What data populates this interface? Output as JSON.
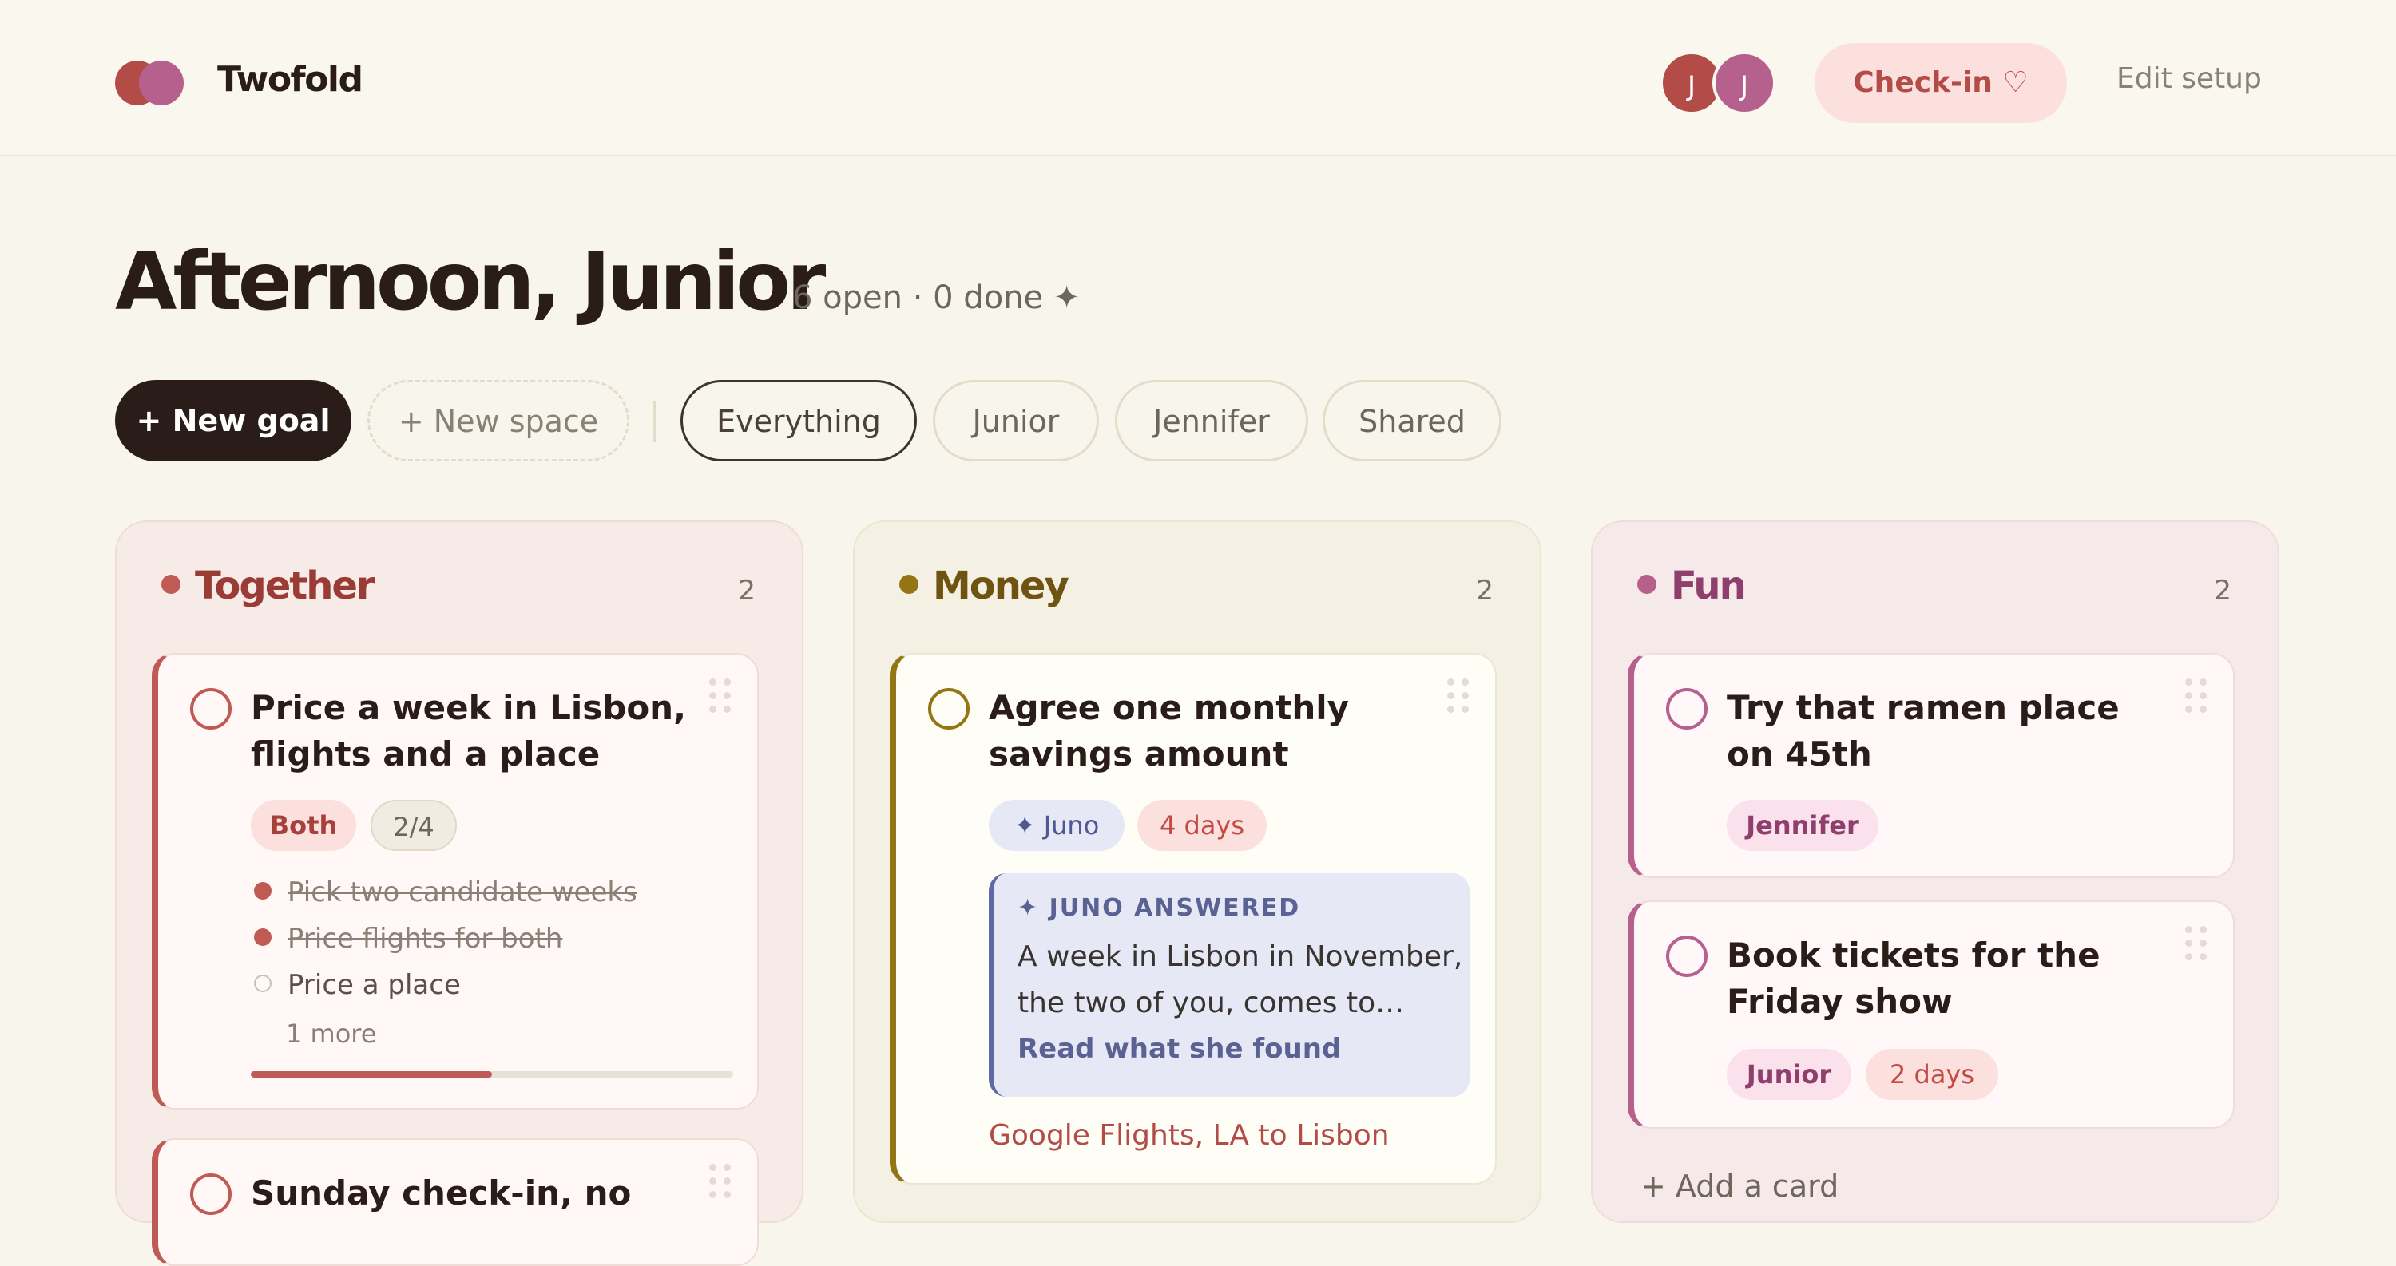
{
  "app": {
    "name": "Twofold"
  },
  "header": {
    "avatars": [
      {
        "initial": "J",
        "color": "#b34b46"
      },
      {
        "initial": "J",
        "color": "#b6608e"
      }
    ],
    "checkin_label": "Check-in ♡",
    "edit_label": "Edit setup"
  },
  "greeting": {
    "title": "Afternoon, Junior",
    "summary": "6 open · 0 done ✦"
  },
  "toolbar": {
    "new_goal": "+ New goal",
    "new_space": "+ New space",
    "filters": [
      "Everything",
      "Junior",
      "Jennifer",
      "Shared"
    ],
    "active_filter": "Everything"
  },
  "columns": [
    {
      "name": "Together",
      "count": "2",
      "color": "#b34b46",
      "cards": [
        {
          "title": "Price a week in Lisbon, flights and a place",
          "tags": [
            "Both",
            "2/4"
          ],
          "subtasks": [
            {
              "label": "Pick two candidate weeks",
              "done": true
            },
            {
              "label": "Price flights for both",
              "done": true
            },
            {
              "label": "Price a place",
              "done": false
            }
          ],
          "more": "1 more",
          "progress": 0.5
        },
        {
          "title": "Sunday check-in, no"
        }
      ]
    },
    {
      "name": "Money",
      "count": "2",
      "color": "#8a6a10",
      "cards": [
        {
          "title": "Agree one monthly savings amount",
          "tags": [
            "✦ Juno",
            "4 days"
          ],
          "juno": {
            "heading": "✦ JUNO ANSWERED",
            "text": "A week in Lisbon in November, the two of you, comes to…",
            "link": "Read what she found"
          },
          "link": "Google Flights, LA to Lisbon"
        }
      ]
    },
    {
      "name": "Fun",
      "count": "2",
      "color": "#a44f80",
      "cards": [
        {
          "title": "Try that ramen place on 45th",
          "tags": [
            "Jennifer"
          ]
        },
        {
          "title": "Book tickets for the Friday show",
          "tags": [
            "Junior",
            "2 days"
          ]
        }
      ],
      "add_card": "+ Add a card"
    }
  ]
}
